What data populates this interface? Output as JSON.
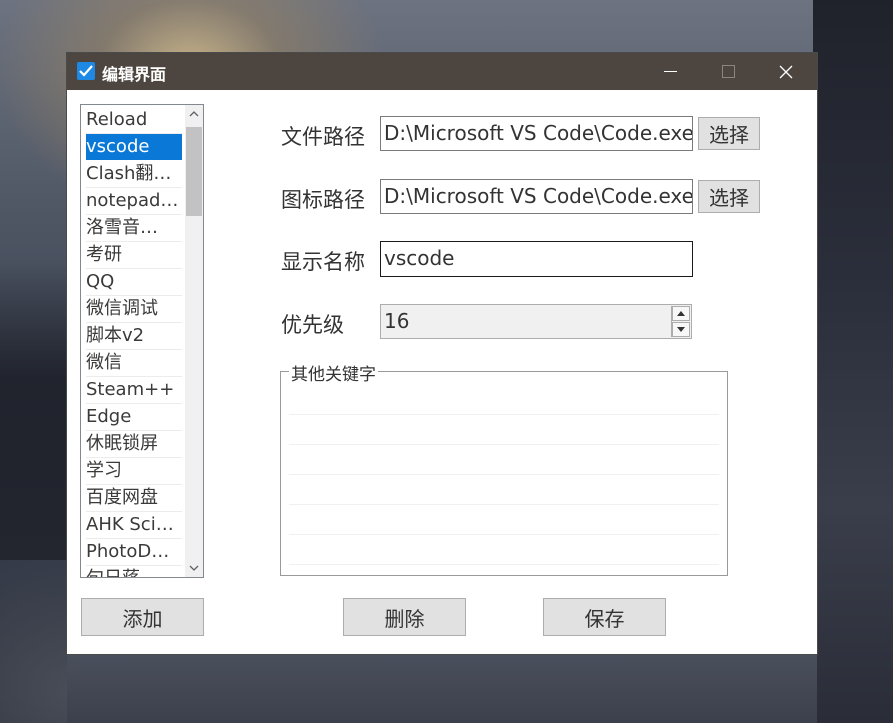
{
  "window": {
    "title": "编辑界面",
    "controls": [
      "minimize",
      "maximize",
      "close"
    ]
  },
  "list": {
    "items": [
      "Reload",
      "vscode",
      "Clash翻…",
      "notepad…",
      "洛雪音…",
      "考研",
      "QQ",
      "微信调试",
      "脚本v2",
      "微信",
      "Steam++",
      "Edge",
      "休眠锁屏",
      "学习",
      "百度网盘",
      "AHK Sci…",
      "PhotoD…",
      "句日蒋"
    ],
    "selected": "vscode"
  },
  "form": {
    "file_path_label": "文件路径",
    "file_path_value": "D:\\Microsoft VS Code\\Code.exe",
    "icon_path_label": "图标路径",
    "icon_path_value": "D:\\Microsoft VS Code\\Code.exe",
    "choose_label": "选择",
    "display_name_label": "显示名称",
    "display_name_value": "vscode",
    "priority_label": "优先级",
    "priority_value": "16",
    "keywords_label": "其他关键字"
  },
  "buttons": {
    "add": "添加",
    "delete": "删除",
    "save": "保存"
  },
  "colors": {
    "titlebar": "#4d4640",
    "selection": "#0a78d7",
    "app_icon": "#1e88e5"
  }
}
